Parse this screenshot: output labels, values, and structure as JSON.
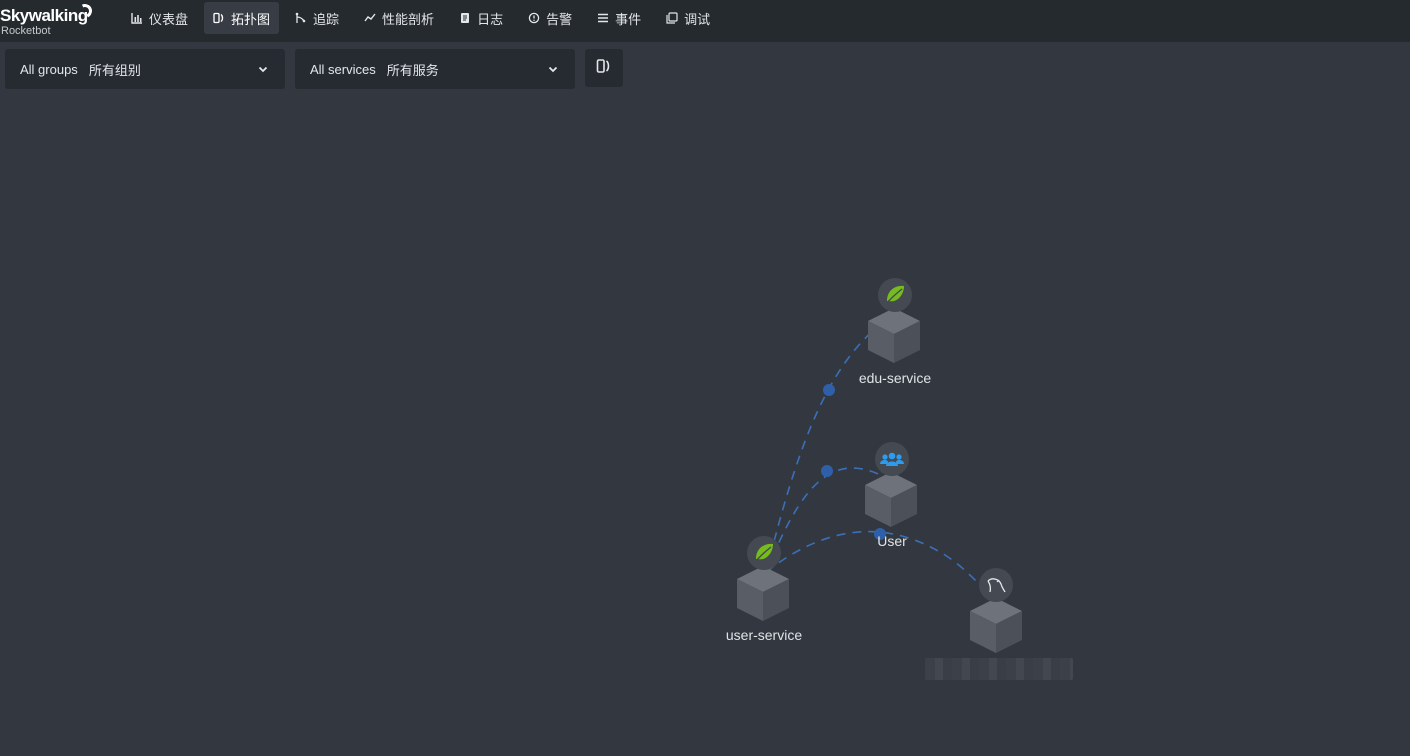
{
  "app": {
    "logo_title": "Skywalking",
    "logo_subtitle": "Rocketbot"
  },
  "nav": {
    "items": [
      {
        "label": "仪表盘",
        "icon": "dashboard-icon"
      },
      {
        "label": "拓扑图",
        "icon": "topology-icon",
        "active": true
      },
      {
        "label": "追踪",
        "icon": "trace-icon"
      },
      {
        "label": "性能剖析",
        "icon": "profile-icon"
      },
      {
        "label": "日志",
        "icon": "log-icon"
      },
      {
        "label": "告警",
        "icon": "alarm-icon"
      },
      {
        "label": "事件",
        "icon": "event-icon"
      },
      {
        "label": "调试",
        "icon": "debug-icon"
      }
    ]
  },
  "filters": {
    "group_label": "All groups",
    "group_value": "所有组别",
    "service_label": "All services",
    "service_value": "所有服务"
  },
  "topology": {
    "nodes": [
      {
        "name": "edu-service",
        "type": "spring"
      },
      {
        "name": "User",
        "type": "user"
      },
      {
        "name": "user-service",
        "type": "spring"
      },
      {
        "name": "",
        "type": "mysql"
      }
    ],
    "colors": {
      "edge": "#3b6fb6",
      "cube_top": "#6d727b",
      "cube_left": "#555a63",
      "cube_right": "#4a4f58",
      "spring": "#77bc1f",
      "user": "#2d9cf0"
    }
  }
}
